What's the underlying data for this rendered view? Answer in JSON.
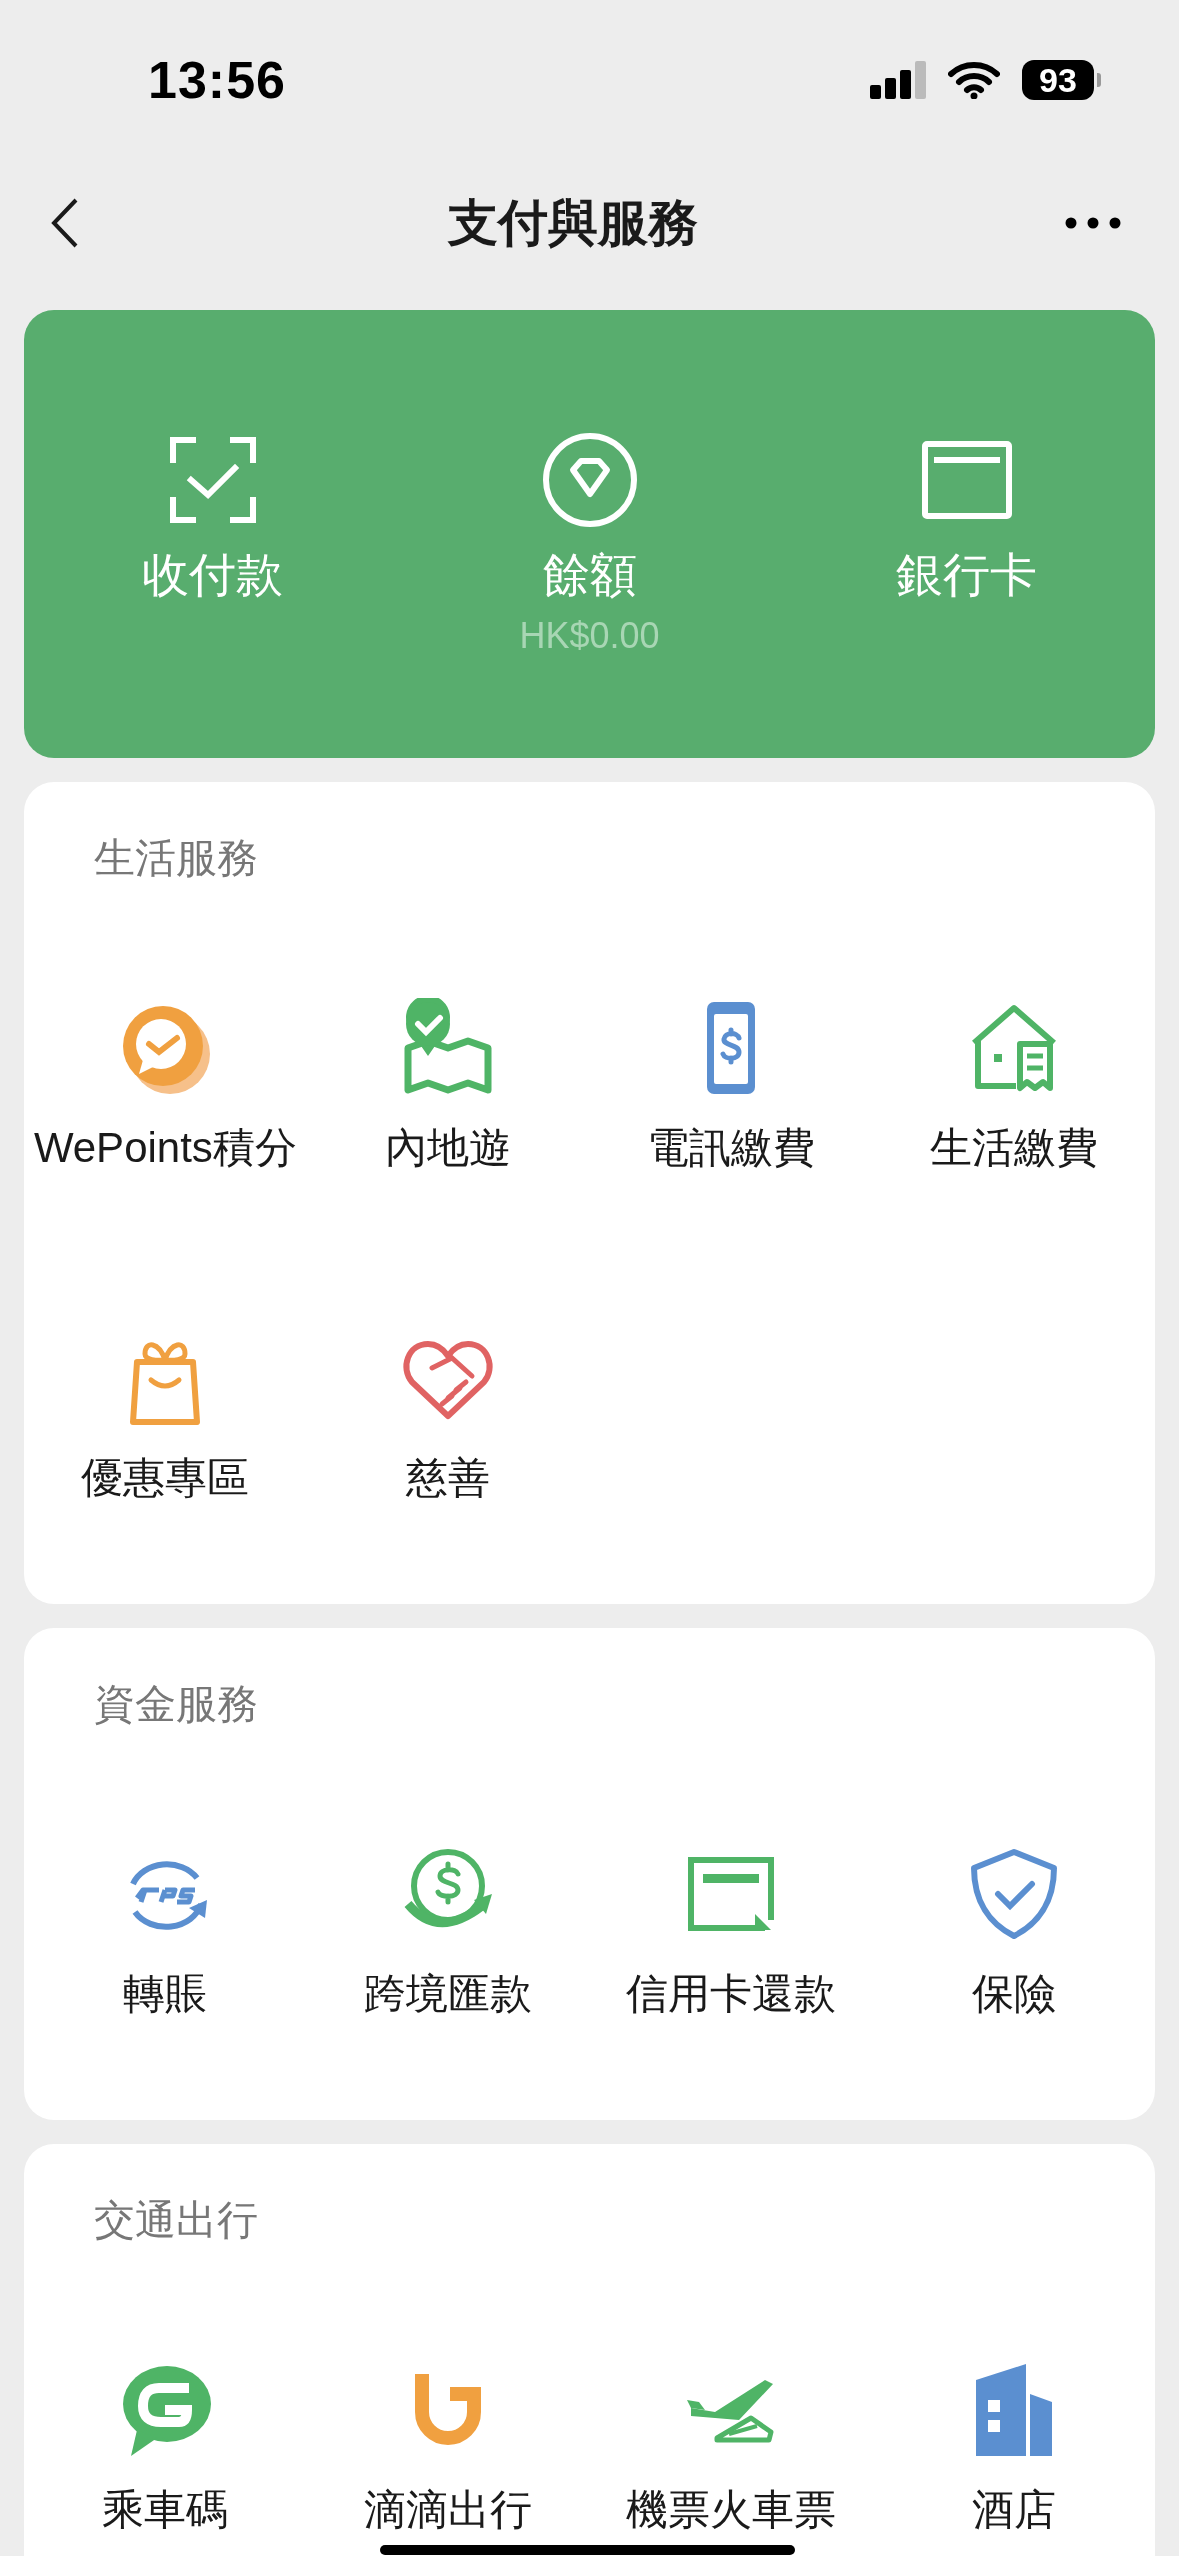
{
  "status_bar": {
    "time": "13:56",
    "battery": "93"
  },
  "nav": {
    "title": "支付與服務"
  },
  "wallet": [
    {
      "label": "收付款"
    },
    {
      "label": "餘額",
      "sub": "HK$0.00"
    },
    {
      "label": "銀行卡"
    }
  ],
  "sections": [
    {
      "title": "生活服務",
      "items": [
        {
          "label": "WePoints積分"
        },
        {
          "label": "內地遊"
        },
        {
          "label": "電訊繳費"
        },
        {
          "label": "生活繳費"
        },
        {
          "label": "優惠專區"
        },
        {
          "label": "慈善"
        }
      ]
    },
    {
      "title": "資金服務",
      "items": [
        {
          "label": "轉賬"
        },
        {
          "label": "跨境匯款"
        },
        {
          "label": "信用卡還款"
        },
        {
          "label": "保險"
        }
      ]
    },
    {
      "title": "交通出行",
      "items": [
        {
          "label": "乘車碼"
        },
        {
          "label": "滴滴出行"
        },
        {
          "label": "機票火車票"
        },
        {
          "label": "酒店"
        }
      ]
    }
  ]
}
